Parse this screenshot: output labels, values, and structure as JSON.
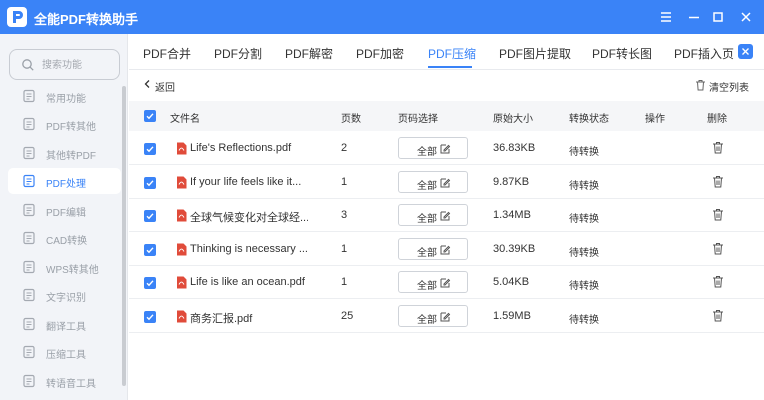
{
  "app": {
    "title": "全能PDF转换助手"
  },
  "sidebar": {
    "search_placeholder": "搜索功能",
    "items": [
      {
        "label": "常用功能",
        "icon": "star-icon"
      },
      {
        "label": "PDF转其他",
        "icon": "pdf-export-icon"
      },
      {
        "label": "其他转PDF",
        "icon": "pdf-import-icon"
      },
      {
        "label": "PDF处理",
        "icon": "pdf-process-icon"
      },
      {
        "label": "PDF编辑",
        "icon": "pdf-edit-icon"
      },
      {
        "label": "CAD转换",
        "icon": "cad-icon"
      },
      {
        "label": "WPS转其他",
        "icon": "wps-icon"
      },
      {
        "label": "文字识别",
        "icon": "ocr-icon"
      },
      {
        "label": "翻译工具",
        "icon": "translate-icon"
      },
      {
        "label": "压缩工具",
        "icon": "compress-icon"
      },
      {
        "label": "转语音工具",
        "icon": "speech-icon"
      }
    ],
    "active_index": 3
  },
  "tabs": {
    "items": [
      "PDF合并",
      "PDF分割",
      "PDF解密",
      "PDF加密",
      "PDF压缩",
      "PDF图片提取",
      "PDF转长图",
      "PDF插入页"
    ],
    "active_index": 4
  },
  "toolbar": {
    "back_label": "返回",
    "clear_label": "清空列表"
  },
  "table": {
    "headers": {
      "filename": "文件名",
      "pages": "页数",
      "page_select": "页码选择",
      "original_size": "原始大小",
      "status": "转换状态",
      "action": "操作",
      "delete": "删除"
    },
    "page_select_label": "全部",
    "rows": [
      {
        "name": "Life's Reflections.pdf",
        "pages": "2",
        "size": "36.83KB",
        "status": "待转换"
      },
      {
        "name": "If your life feels like it...",
        "pages": "1",
        "size": "9.87KB",
        "status": "待转换"
      },
      {
        "name": "全球气候变化对全球经...",
        "pages": "3",
        "size": "1.34MB",
        "status": "待转换"
      },
      {
        "name": "Thinking is necessary ...",
        "pages": "1",
        "size": "30.39KB",
        "status": "待转换"
      },
      {
        "name": "Life is like an ocean.pdf",
        "pages": "1",
        "size": "5.04KB",
        "status": "待转换"
      },
      {
        "name": "商务汇报.pdf",
        "pages": "25",
        "size": "1.59MB",
        "status": "待转换"
      }
    ]
  },
  "colors": {
    "accent": "#3a83f7",
    "pdf_icon": "#e04b3a"
  }
}
